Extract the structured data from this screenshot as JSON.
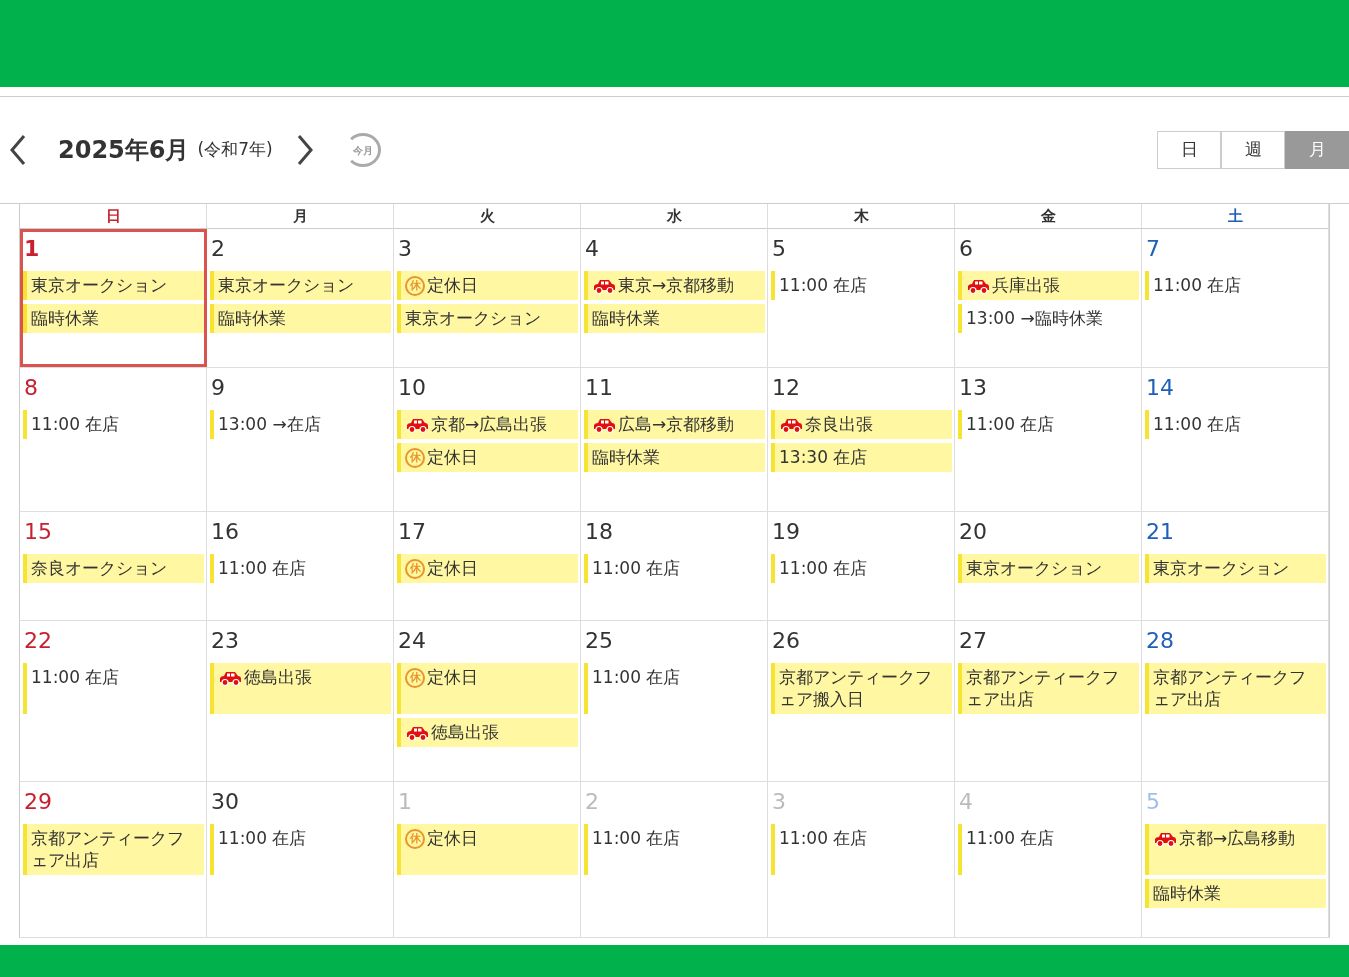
{
  "toolbar": {
    "title": "2025年6月",
    "era": "(令和7年)",
    "today_button": {
      "label": "今月"
    },
    "views": [
      {
        "label": "日",
        "selected": false
      },
      {
        "label": "週",
        "selected": false
      },
      {
        "label": "月",
        "selected": true
      }
    ]
  },
  "weekdays": [
    "日",
    "月",
    "火",
    "水",
    "木",
    "金",
    "土"
  ],
  "weeks": [
    {
      "days": [
        {
          "day": "1",
          "other_month": false,
          "today": true,
          "events": [
            {
              "text": "東京オークション",
              "kind": "plain",
              "filled": true
            },
            {
              "text": "臨時休業",
              "kind": "plain",
              "filled": true
            }
          ]
        },
        {
          "day": "2",
          "other_month": false,
          "today": false,
          "events": [
            {
              "text": "東京オークション",
              "kind": "plain",
              "filled": true
            },
            {
              "text": "臨時休業",
              "kind": "plain",
              "filled": true
            }
          ]
        },
        {
          "day": "3",
          "other_month": false,
          "today": false,
          "events": [
            {
              "text": "定休日",
              "kind": "holiday",
              "icon_label": "休",
              "filled": true
            },
            {
              "text": "東京オークション",
              "kind": "plain",
              "filled": true
            }
          ]
        },
        {
          "day": "4",
          "other_month": false,
          "today": false,
          "events": [
            {
              "text": "東京→京都移動",
              "kind": "car",
              "filled": true
            },
            {
              "text": "臨時休業",
              "kind": "plain",
              "filled": true
            }
          ]
        },
        {
          "day": "5",
          "other_month": false,
          "today": false,
          "events": [
            {
              "text": "11:00 在店",
              "kind": "plain",
              "filled": false
            }
          ]
        },
        {
          "day": "6",
          "other_month": false,
          "today": false,
          "events": [
            {
              "text": "兵庫出張",
              "kind": "car",
              "filled": true
            },
            {
              "text": "13:00 →臨時休業",
              "kind": "plain",
              "filled": false
            }
          ]
        },
        {
          "day": "7",
          "other_month": false,
          "today": false,
          "events": [
            {
              "text": "11:00 在店",
              "kind": "plain",
              "filled": false
            }
          ]
        }
      ]
    },
    {
      "days": [
        {
          "day": "8",
          "other_month": false,
          "today": false,
          "events": [
            {
              "text": "11:00 在店",
              "kind": "plain",
              "filled": false
            }
          ]
        },
        {
          "day": "9",
          "other_month": false,
          "today": false,
          "events": [
            {
              "text": "13:00 →在店",
              "kind": "plain",
              "filled": false
            }
          ]
        },
        {
          "day": "10",
          "other_month": false,
          "today": false,
          "events": [
            {
              "text": "京都→広島出張",
              "kind": "car",
              "filled": true
            },
            {
              "text": "定休日",
              "kind": "holiday",
              "icon_label": "休",
              "filled": true
            }
          ]
        },
        {
          "day": "11",
          "other_month": false,
          "today": false,
          "events": [
            {
              "text": "広島→京都移動",
              "kind": "car",
              "filled": true
            },
            {
              "text": "臨時休業",
              "kind": "plain",
              "filled": true
            }
          ]
        },
        {
          "day": "12",
          "other_month": false,
          "today": false,
          "events": [
            {
              "text": "奈良出張",
              "kind": "car",
              "filled": true
            },
            {
              "text": "13:30 在店",
              "kind": "plain",
              "filled": true
            }
          ]
        },
        {
          "day": "13",
          "other_month": false,
          "today": false,
          "events": [
            {
              "text": "11:00 在店",
              "kind": "plain",
              "filled": false
            }
          ]
        },
        {
          "day": "14",
          "other_month": false,
          "today": false,
          "events": [
            {
              "text": "11:00 在店",
              "kind": "plain",
              "filled": false
            }
          ]
        }
      ]
    },
    {
      "days": [
        {
          "day": "15",
          "other_month": false,
          "today": false,
          "events": [
            {
              "text": "奈良オークション",
              "kind": "plain",
              "filled": true
            }
          ]
        },
        {
          "day": "16",
          "other_month": false,
          "today": false,
          "events": [
            {
              "text": "11:00 在店",
              "kind": "plain",
              "filled": false
            }
          ]
        },
        {
          "day": "17",
          "other_month": false,
          "today": false,
          "events": [
            {
              "text": "定休日",
              "kind": "holiday",
              "icon_label": "休",
              "filled": true
            }
          ]
        },
        {
          "day": "18",
          "other_month": false,
          "today": false,
          "events": [
            {
              "text": "11:00 在店",
              "kind": "plain",
              "filled": false
            }
          ]
        },
        {
          "day": "19",
          "other_month": false,
          "today": false,
          "events": [
            {
              "text": "11:00 在店",
              "kind": "plain",
              "filled": false
            }
          ]
        },
        {
          "day": "20",
          "other_month": false,
          "today": false,
          "events": [
            {
              "text": "東京オークション",
              "kind": "plain",
              "filled": true
            }
          ]
        },
        {
          "day": "21",
          "other_month": false,
          "today": false,
          "events": [
            {
              "text": "東京オークション",
              "kind": "plain",
              "filled": true
            }
          ]
        }
      ]
    },
    {
      "days": [
        {
          "day": "22",
          "other_month": false,
          "today": false,
          "events": [
            {
              "text": "11:00 在店",
              "kind": "plain",
              "filled": false
            }
          ]
        },
        {
          "day": "23",
          "other_month": false,
          "today": false,
          "events": [
            {
              "text": "徳島出張",
              "kind": "car",
              "filled": true
            }
          ]
        },
        {
          "day": "24",
          "other_month": false,
          "today": false,
          "events": [
            {
              "text": "定休日",
              "kind": "holiday",
              "icon_label": "休",
              "filled": true
            },
            {
              "text": "徳島出張",
              "kind": "car",
              "filled": true
            }
          ]
        },
        {
          "day": "25",
          "other_month": false,
          "today": false,
          "events": [
            {
              "text": "11:00 在店",
              "kind": "plain",
              "filled": false
            }
          ]
        },
        {
          "day": "26",
          "other_month": false,
          "today": false,
          "events": [
            {
              "text": "京都アンティークフェア搬入日",
              "kind": "plain",
              "filled": true
            }
          ]
        },
        {
          "day": "27",
          "other_month": false,
          "today": false,
          "events": [
            {
              "text": "京都アンティークフェア出店",
              "kind": "plain",
              "filled": true
            }
          ]
        },
        {
          "day": "28",
          "other_month": false,
          "today": false,
          "events": [
            {
              "text": "京都アンティークフェア出店",
              "kind": "plain",
              "filled": true
            }
          ]
        }
      ]
    },
    {
      "days": [
        {
          "day": "29",
          "other_month": false,
          "today": false,
          "events": [
            {
              "text": "京都アンティークフェア出店",
              "kind": "plain",
              "filled": true
            }
          ]
        },
        {
          "day": "30",
          "other_month": false,
          "today": false,
          "events": [
            {
              "text": "11:00 在店",
              "kind": "plain",
              "filled": false
            }
          ]
        },
        {
          "day": "1",
          "other_month": true,
          "today": false,
          "events": [
            {
              "text": "定休日",
              "kind": "holiday",
              "icon_label": "休",
              "filled": true
            }
          ]
        },
        {
          "day": "2",
          "other_month": true,
          "today": false,
          "events": [
            {
              "text": "11:00 在店",
              "kind": "plain",
              "filled": false
            }
          ]
        },
        {
          "day": "3",
          "other_month": true,
          "today": false,
          "events": [
            {
              "text": "11:00 在店",
              "kind": "plain",
              "filled": false
            }
          ]
        },
        {
          "day": "4",
          "other_month": true,
          "today": false,
          "events": [
            {
              "text": "11:00 在店",
              "kind": "plain",
              "filled": false
            }
          ]
        },
        {
          "day": "5",
          "other_month": true,
          "today": false,
          "events": [
            {
              "text": "京都→広島移動",
              "kind": "car",
              "filled": true
            },
            {
              "text": "臨時休業",
              "kind": "plain",
              "filled": true
            }
          ]
        }
      ]
    }
  ]
}
